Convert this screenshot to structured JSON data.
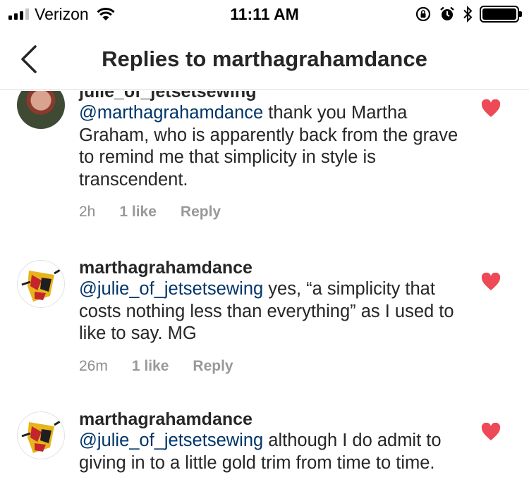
{
  "status_bar": {
    "carrier": "Verizon",
    "time": "11:11 AM",
    "icons": [
      "signal-icon",
      "wifi-icon",
      "rotation-lock-icon",
      "alarm-icon",
      "bluetooth-icon",
      "battery-icon"
    ]
  },
  "header": {
    "back_icon": "chevron-left-icon",
    "title": "Replies to marthagrahamdance"
  },
  "comments": [
    {
      "username": "julie_of_jetsetsewing",
      "mention": "@marthagrahamdance",
      "text": " thank you Martha Graham, who is apparently back from the grave to remind me that simplicity in style is transcendent.",
      "age": "2h",
      "likes": "1 like",
      "reply": "Reply",
      "liked": true
    },
    {
      "username": "marthagrahamdance",
      "mention": "@julie_of_jetsetsewing",
      "text": " yes, “a simplicity that costs nothing less than everything” as I used to like to say. MG",
      "age": "26m",
      "likes": "1 like",
      "reply": "Reply",
      "liked": true
    },
    {
      "username": "marthagrahamdance",
      "mention": "@julie_of_jetsetsewing",
      "text": " although I do admit to giving in to a little gold trim from time to time.",
      "liked": true
    }
  ],
  "colors": {
    "heart": "#ed4956",
    "mention": "#003569",
    "meta": "#8e8e8e",
    "text": "#262626"
  }
}
